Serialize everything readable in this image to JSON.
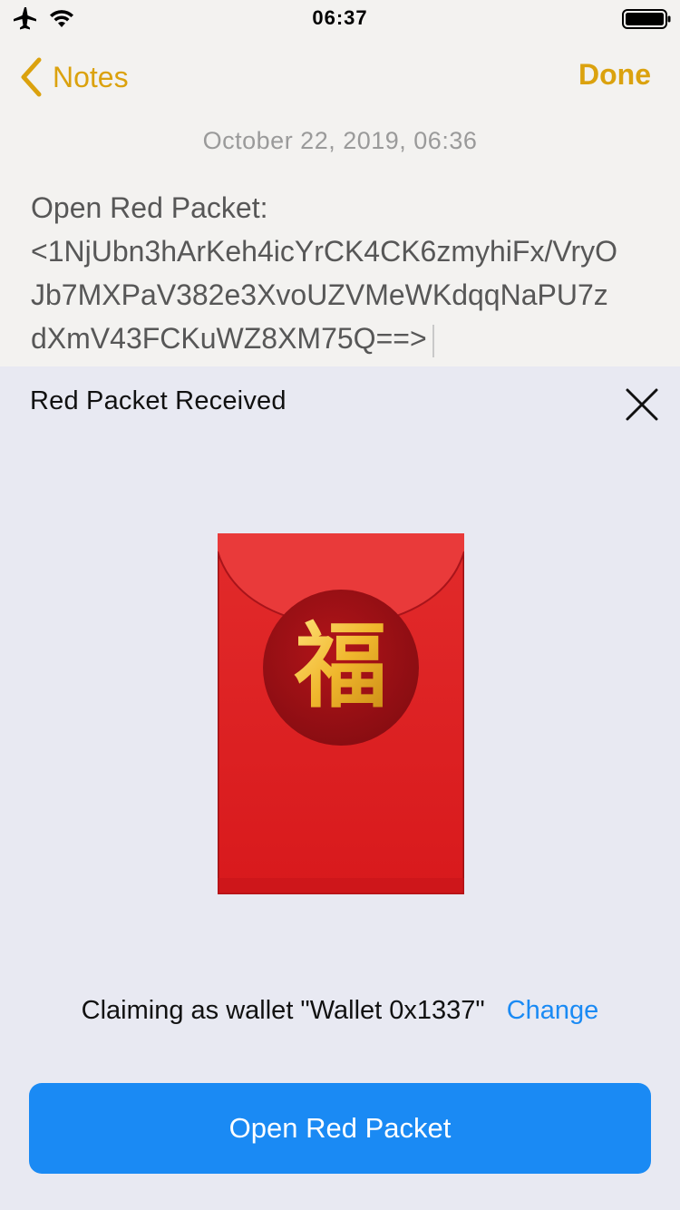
{
  "status_bar": {
    "time": "06:37",
    "icons": [
      "airplane-icon",
      "wifi-icon",
      "battery-icon"
    ]
  },
  "nav": {
    "back_label": "Notes",
    "done_label": "Done",
    "accent_color": "#dba20e"
  },
  "note": {
    "date": "October 22, 2019, 06:36",
    "lines": [
      "Open Red Packet:",
      "<1NjUbn3hArKeh4icYrCK4CK6zmyhiFx/VryO",
      "Jb7MXPaV382e3XvoUZVMeWKdqqNaPU7z",
      "dXmV43FCKuWZ8XM75Q==>"
    ]
  },
  "sheet": {
    "title": "Red Packet Received",
    "close_icon": "close-icon",
    "envelope_character": "福",
    "claim_text": "Claiming as wallet \"Wallet 0x1337\"",
    "change_label": "Change",
    "open_button_label": "Open Red Packet",
    "accent_color": "#1a8af4"
  }
}
